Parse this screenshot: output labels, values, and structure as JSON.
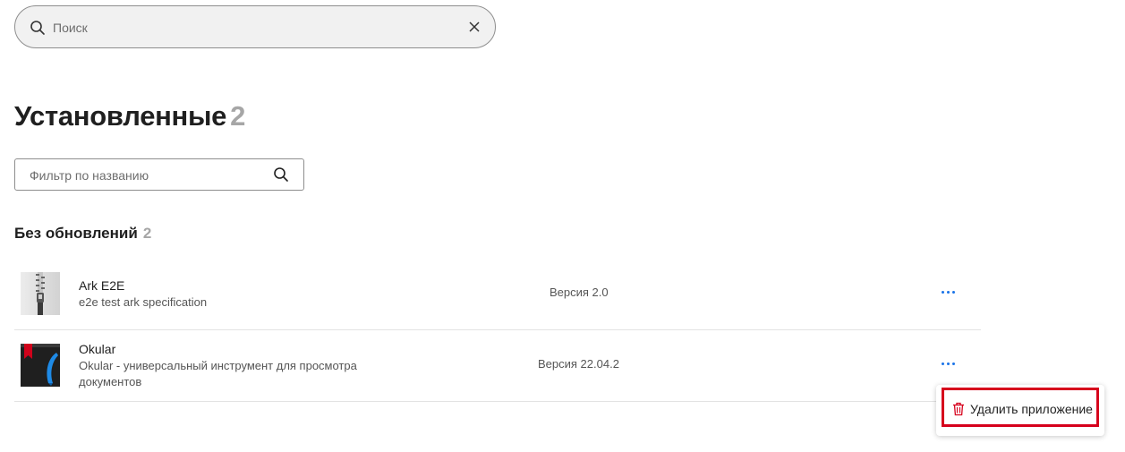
{
  "search": {
    "placeholder": "Поиск",
    "value": ""
  },
  "installed": {
    "title": "Установленные",
    "count": "2"
  },
  "filter": {
    "placeholder": "Фильтр по названию",
    "value": ""
  },
  "section": {
    "title": "Без обновлений",
    "count": "2"
  },
  "apps": [
    {
      "name": "Ark E2E",
      "description": "e2e test ark specification",
      "version": "Версия 2.0",
      "icon": "archive-zip-icon"
    },
    {
      "name": "Okular",
      "description": "Okular - универсальный инструмент для просмотра документов",
      "version": "Версия 22.04.2",
      "icon": "okular-icon"
    }
  ],
  "context_menu": {
    "delete_label": "Удалить приложение",
    "icon": "trash-icon"
  },
  "colors": {
    "accent": "#1a73e8",
    "danger": "#d6001c",
    "muted_count": "#a6a6a6"
  }
}
